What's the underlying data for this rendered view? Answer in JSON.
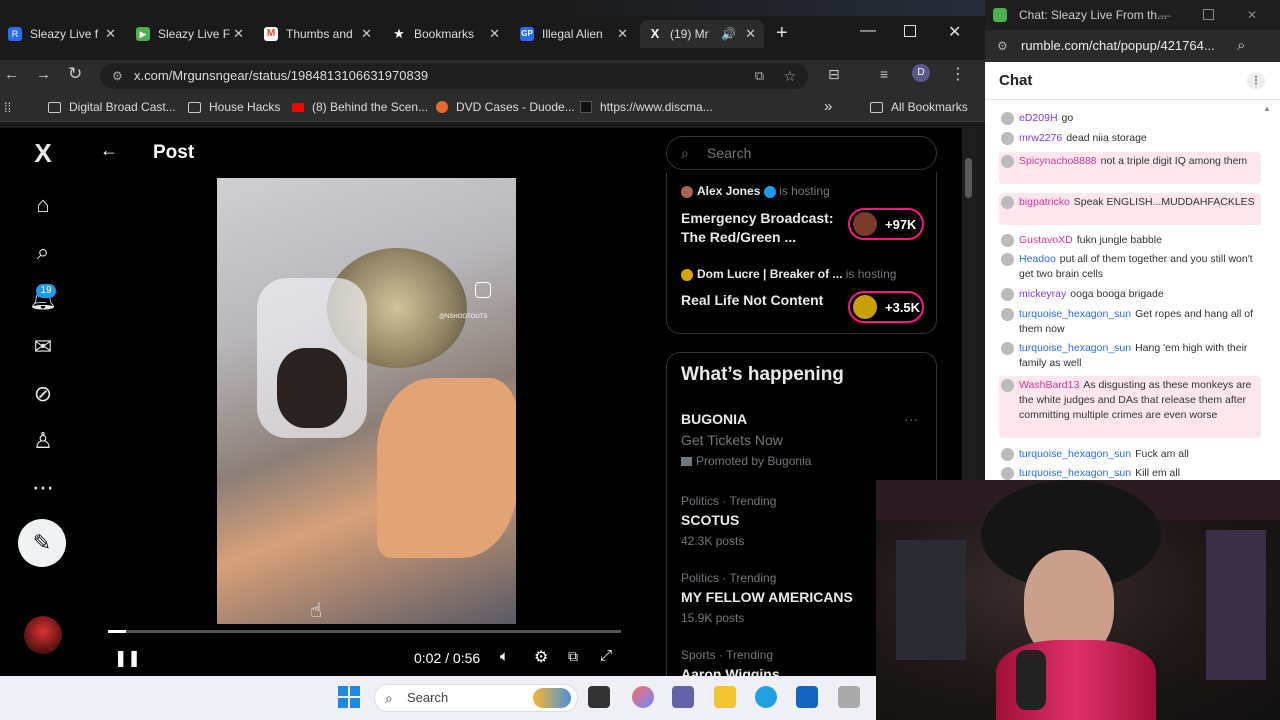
{
  "browser": {
    "tabs": [
      {
        "title": "Sleazy Live f",
        "color": "#2b6cf6",
        "letter": "R"
      },
      {
        "title": "Sleazy Live F",
        "color": "#4caf50",
        "letter": "▶"
      },
      {
        "title": "Thumbs and",
        "color": "#ea4335",
        "letter": "M"
      },
      {
        "title": "Bookmarks",
        "color": "#f5f5f5",
        "letter": "★"
      },
      {
        "title": "Illegal Alien",
        "color": "#2b6cf6",
        "letter": "GP"
      },
      {
        "title": "(19) Mr",
        "color": "#ffffff",
        "letter": "X"
      }
    ],
    "new_tab": "+",
    "url": "x.com/Mrgunsngear/status/1984813106631970839",
    "profile_letter": "D",
    "bookmarks": [
      "Digital Broad Cast...",
      "House Hacks",
      "(8) Behind the Scen...",
      "DVD Cases - Duode...",
      "https://www.discma..."
    ],
    "more_bookmarks": "»",
    "all_bookmarks": "All Bookmarks"
  },
  "x": {
    "logo": "X",
    "notification_count": "19",
    "post_title": "Post",
    "video_watermark": "@NSHOOTOUTS",
    "time_display": "0:02 / 0:56",
    "progress": 0.036,
    "search_placeholder": "Search",
    "live": [
      {
        "host": "Alex Jones",
        "hosting": "is hosting",
        "title": "Emergency Broadcast: The Red/Green ...",
        "count": "+97K"
      },
      {
        "host": "Dom Lucre | Breaker of ...",
        "hosting": "is hosting",
        "title": "Real Life Not Content",
        "count": "+3.5K"
      }
    ],
    "whats_happening": "What’s happening",
    "promo": {
      "name": "BUGONIA",
      "tagline": "Get Tickets Now",
      "promoted": "Promoted by Bugonia",
      "more": "···"
    },
    "trends": [
      {
        "category": "Politics · Trending",
        "name": "SCOTUS",
        "count": "42.3K posts"
      },
      {
        "category": "Politics · Trending",
        "name": "MY FELLOW AMERICANS",
        "count": "15.9K posts"
      },
      {
        "category": "Sports · Trending",
        "name": "Aaron Wiggins",
        "count": ""
      }
    ]
  },
  "taskbar": {
    "search": "Search"
  },
  "chat": {
    "window_title": "Chat: Sleazy Live From th...",
    "url": "rumble.com/chat/popup/421764...",
    "header": "Chat",
    "messages": [
      {
        "user": "eD209H",
        "text": "go",
        "color": "#7b3fe4",
        "hl": false
      },
      {
        "user": "mrw2276",
        "text": "dead niia storage",
        "color": "#7b3fe4",
        "hl": false
      },
      {
        "user": "Spicynacho8888",
        "text": "not a triple digit IQ among them",
        "color": "#e0329a",
        "hl": true
      },
      {
        "user": "bigpatricko",
        "text": "Speak ENGLISH...MUDDAHFACKLES",
        "color": "#e0329a",
        "hl": true
      },
      {
        "user": "GustavoXD",
        "text": "fukn jungle babble",
        "color": "#e0329a",
        "hl": false
      },
      {
        "user": "Headoo",
        "text": "put all of them together and you still won't get two brain cells",
        "color": "#2b6cf6",
        "hl": false
      },
      {
        "user": "mickeyray",
        "text": "ooga booga brigade",
        "color": "#7b3fe4",
        "hl": false
      },
      {
        "user": "turquoise_hexagon_sun",
        "text": "Get ropes and hang all of them now",
        "color": "#2b6cf6",
        "hl": false
      },
      {
        "user": "turquoise_hexagon_sun",
        "text": "Hang 'em high with their family as well",
        "color": "#2b6cf6",
        "hl": false
      },
      {
        "user": "WashBard13",
        "text": "As disgusting as these monkeys are the white judges and DAs that release them after committing multiple crimes are even worse",
        "color": "#e0329a",
        "hl": true
      },
      {
        "user": "turquoise_hexagon_sun",
        "text": "Fuck am all",
        "color": "#2b6cf6",
        "hl": false
      },
      {
        "user": "turquoise_hexagon_sun",
        "text": "Kill em all",
        "color": "#2b6cf6",
        "hl": false
      }
    ]
  }
}
